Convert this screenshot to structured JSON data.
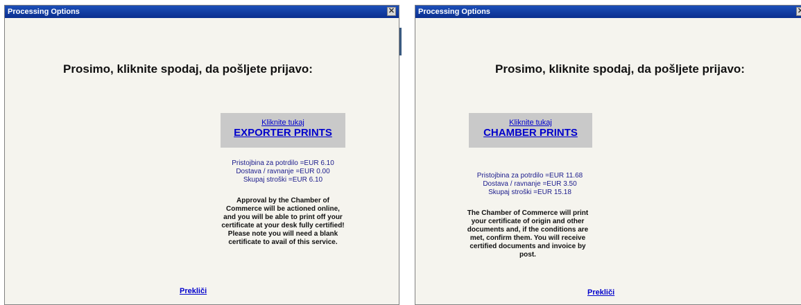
{
  "dialogs": [
    {
      "title": "Processing Options",
      "close_glyph": "✕",
      "heading": "Prosimo, kliknite spodaj, da pošljete prijavo:",
      "click_here": "Kliknite tukaj",
      "option_label": "EXPORTER PRINTS",
      "fees": {
        "certificate": "Pristojbina za potrdilo =EUR 6.10",
        "delivery": "Dostava / ravnanje =EUR 0.00",
        "total": "Skupaj stroški =EUR 6.10"
      },
      "description": "Approval by the Chamber of Commerce will be actioned online, and you will be able to print off your certificate at your desk fully certified! Please note you will need a blank certificate to avail of this service.",
      "cancel": "Prekliči"
    },
    {
      "title": "Processing Options",
      "close_glyph": "✕",
      "heading": "Prosimo, kliknite spodaj, da pošljete prijavo:",
      "click_here": "Kliknite tukaj",
      "option_label": "CHAMBER PRINTS",
      "fees": {
        "certificate": "Pristojbina za potrdilo =EUR 11.68",
        "delivery": "Dostava / ravnanje =EUR 3.50",
        "total": "Skupaj stroški =EUR 15.18"
      },
      "description": "The Chamber of Commerce will print your certificate of origin and other documents and, if the conditions are met, confirm them. You will receive certified documents and invoice by post.",
      "cancel": "Prekliči"
    }
  ],
  "colors": {
    "titlebar": "#0a2f8f",
    "dialog_bg": "#f5f4ee",
    "link": "#0000cc",
    "fee_text": "#1b1b8c",
    "option_box": "#c9c9c9"
  }
}
